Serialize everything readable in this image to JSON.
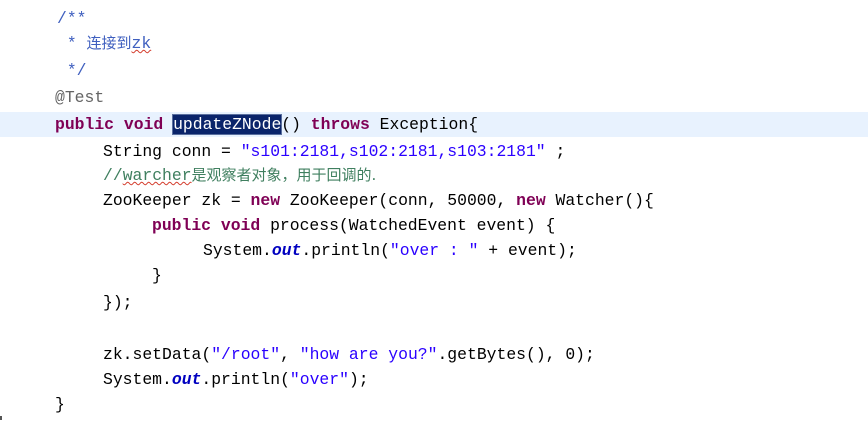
{
  "editor": {
    "lines": [
      {
        "indent": 57,
        "tokens": [
          {
            "cls": "cm",
            "text": "/**"
          }
        ]
      },
      {
        "indent": 57,
        "tokens": [
          {
            "cls": "cm",
            "text": " * "
          },
          {
            "cls": "cm cj",
            "text": "连接到"
          },
          {
            "cls": "cm sq",
            "text": "zk"
          }
        ]
      },
      {
        "indent": 57,
        "tokens": [
          {
            "cls": "cm",
            "text": " */"
          }
        ]
      },
      {
        "indent": 55,
        "tokens": [
          {
            "cls": "an",
            "text": "@Test"
          }
        ]
      },
      {
        "indent": 55,
        "current": true,
        "tokens": [
          {
            "cls": "kw",
            "text": "public"
          },
          {
            "cls": "",
            "text": " "
          },
          {
            "cls": "kw",
            "text": "void"
          },
          {
            "cls": "",
            "text": " "
          },
          {
            "cls": "sel",
            "text": "updateZNode"
          },
          {
            "cls": "",
            "text": "() "
          },
          {
            "cls": "kw",
            "text": "throws"
          },
          {
            "cls": "",
            "text": " Exception{"
          }
        ]
      },
      {
        "indent": 103,
        "tokens": [
          {
            "cls": "",
            "text": "String conn = "
          },
          {
            "cls": "str",
            "text": "\"s101:2181,s102:2181,s103:2181\""
          },
          {
            "cls": "",
            "text": " ;"
          }
        ]
      },
      {
        "indent": 103,
        "tokens": [
          {
            "cls": "lc",
            "text": "//"
          },
          {
            "cls": "lc sq",
            "text": "warcher"
          },
          {
            "cls": "lc cj",
            "text": "是观察者对象，用于回调的."
          }
        ]
      },
      {
        "indent": 103,
        "tokens": [
          {
            "cls": "",
            "text": "ZooKeeper zk = "
          },
          {
            "cls": "kw",
            "text": "new"
          },
          {
            "cls": "",
            "text": " ZooKeeper(conn, 50000, "
          },
          {
            "cls": "kw",
            "text": "new"
          },
          {
            "cls": "",
            "text": " Watcher(){"
          }
        ]
      },
      {
        "indent": 152,
        "tokens": [
          {
            "cls": "kw",
            "text": "public"
          },
          {
            "cls": "",
            "text": " "
          },
          {
            "cls": "kw",
            "text": "void"
          },
          {
            "cls": "",
            "text": " process(WatchedEvent event) {"
          }
        ]
      },
      {
        "indent": 203,
        "tokens": [
          {
            "cls": "",
            "text": "System."
          },
          {
            "cls": "fld",
            "text": "out"
          },
          {
            "cls": "",
            "text": ".println("
          },
          {
            "cls": "str",
            "text": "\"over : \""
          },
          {
            "cls": "",
            "text": " + event);"
          }
        ]
      },
      {
        "indent": 152,
        "tokens": [
          {
            "cls": "",
            "text": "}"
          }
        ]
      },
      {
        "indent": 103,
        "tokens": [
          {
            "cls": "",
            "text": "});"
          }
        ]
      },
      {
        "indent": 103,
        "tokens": []
      },
      {
        "indent": 103,
        "tokens": [
          {
            "cls": "",
            "text": "zk.setData("
          },
          {
            "cls": "str",
            "text": "\"/root\""
          },
          {
            "cls": "",
            "text": ", "
          },
          {
            "cls": "str",
            "text": "\"how are you?\""
          },
          {
            "cls": "",
            "text": ".getBytes(), 0);"
          }
        ]
      },
      {
        "indent": 103,
        "tokens": [
          {
            "cls": "",
            "text": "System."
          },
          {
            "cls": "fld",
            "text": "out"
          },
          {
            "cls": "",
            "text": ".println("
          },
          {
            "cls": "str",
            "text": "\"over\""
          },
          {
            "cls": "",
            "text": ");"
          }
        ]
      },
      {
        "indent": 55,
        "tokens": [
          {
            "cls": "",
            "text": "}"
          }
        ]
      }
    ]
  },
  "colors": {
    "keyword": "#7f0055",
    "string": "#2a00ff",
    "javadoc": "#3f5fbf",
    "line_comment": "#3f7f5f",
    "annotation": "#646464",
    "static_field": "#0000c0",
    "selection_bg": "#0a246a",
    "current_line_bg": "#e8f2fe"
  }
}
